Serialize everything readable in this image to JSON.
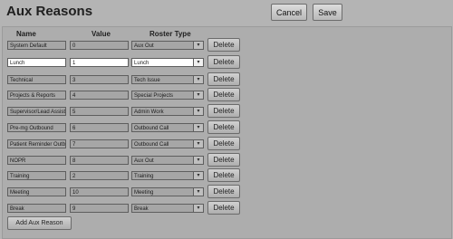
{
  "header": {
    "title": "Aux Reasons",
    "cancel_label": "Cancel",
    "save_label": "Save"
  },
  "columns": {
    "name": "Name",
    "value": "Value",
    "roster_type": "Roster Type"
  },
  "rows": [
    {
      "name": "System Default",
      "value": "0",
      "roster": "Aux Out",
      "delete": "Delete"
    },
    {
      "name": "Lunch",
      "value": "1",
      "roster": "Lunch",
      "delete": "Delete"
    },
    {
      "name": "Technical",
      "value": "3",
      "roster": "Tech Issue",
      "delete": "Delete"
    },
    {
      "name": "Projects & Reports",
      "value": "4",
      "roster": "Special Projects",
      "delete": "Delete"
    },
    {
      "name": "Supervisor/Lead Assist",
      "value": "5",
      "roster": "Admin Work",
      "delete": "Delete"
    },
    {
      "name": "Pre-mg Outbound",
      "value": "6",
      "roster": "Outbound Call",
      "delete": "Delete"
    },
    {
      "name": "Patient Reminder Outbo",
      "value": "7",
      "roster": "Outbound Call",
      "delete": "Delete"
    },
    {
      "name": "NOPR",
      "value": "8",
      "roster": "Aux Out",
      "delete": "Delete"
    },
    {
      "name": "Training",
      "value": "2",
      "roster": "Training",
      "delete": "Delete"
    },
    {
      "name": "Meeting",
      "value": "10",
      "roster": "Meeting",
      "delete": "Delete"
    },
    {
      "name": "Break",
      "value": "9",
      "roster": "Break",
      "delete": "Delete"
    }
  ],
  "footer": {
    "add_label": "Add Aux Reason"
  },
  "icons": {
    "dropdown": "chevron-down-icon"
  },
  "colors": {
    "background": "#b4b4b4",
    "highlight_row": "#ffffff"
  }
}
